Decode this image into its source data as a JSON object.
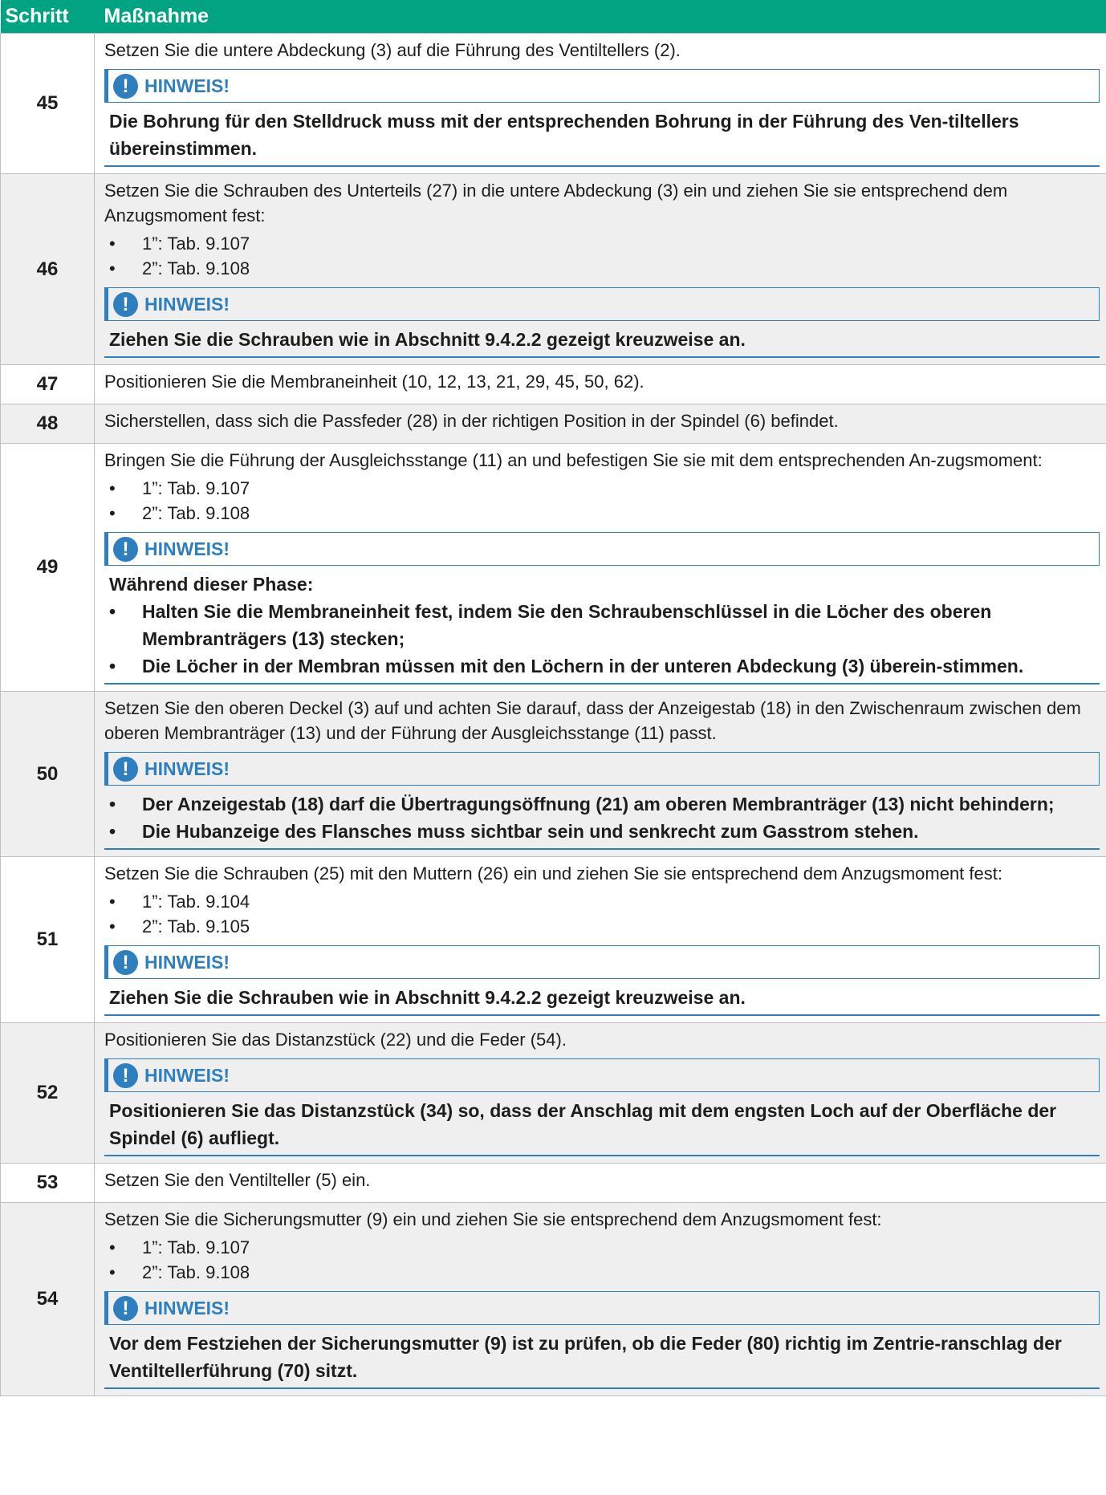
{
  "header": {
    "col_step": "Schritt",
    "col_action": "Maßnahme"
  },
  "note_label": "HINWEIS!",
  "note_icon": "!",
  "bullet": "•",
  "rows": [
    {
      "step": "45",
      "text": [
        "Setzen Sie die untere Abdeckung (3) auf die Führung des Ventiltellers (2)."
      ],
      "bullets": [],
      "note": [
        "Die Bohrung für den Stelldruck muss mit der entsprechenden Bohrung in der Führung des Ven-tiltellers übereinstimmen."
      ],
      "note_bullets": []
    },
    {
      "step": "46",
      "text": [
        "Setzen Sie die Schrauben des Unterteils (27) in die untere Abdeckung (3) ein und ziehen Sie sie entsprechend dem Anzugsmoment fest:"
      ],
      "bullets": [
        "1”: Tab. 9.107",
        "2”: Tab. 9.108"
      ],
      "note": [
        "Ziehen Sie die Schrauben wie in Abschnitt 9.4.2.2 gezeigt kreuzweise an."
      ],
      "note_bullets": []
    },
    {
      "step": "47",
      "text": [
        "Positionieren Sie die Membraneinheit (10, 12, 13, 21, 29, 45, 50, 62)."
      ],
      "bullets": [],
      "note": [],
      "note_bullets": []
    },
    {
      "step": "48",
      "text": [
        "Sicherstellen, dass sich die Passfeder (28) in der richtigen Position in der Spindel (6) befindet."
      ],
      "bullets": [],
      "note": [],
      "note_bullets": []
    },
    {
      "step": "49",
      "text": [
        "Bringen Sie die Führung der Ausgleichsstange (11) an und befestigen Sie sie mit dem entsprechenden An-zugsmoment:"
      ],
      "bullets": [
        "1”: Tab. 9.107",
        "2”: Tab. 9.108"
      ],
      "note": [
        "Während dieser Phase:"
      ],
      "note_bullets": [
        "Halten Sie die Membraneinheit fest, indem Sie den Schraubenschlüssel in die Löcher des oberen Membranträgers (13) stecken;",
        "Die Löcher in der Membran müssen mit den Löchern in der unteren Abdeckung (3) überein-stimmen."
      ]
    },
    {
      "step": "50",
      "text": [
        "Setzen Sie den oberen Deckel (3) auf und achten Sie darauf, dass der Anzeigestab (18) in den Zwischenraum zwischen dem oberen Membranträger (13) und der Führung der Ausgleichsstange (11) passt."
      ],
      "bullets": [],
      "note": [],
      "note_bullets": [
        "Der Anzeigestab (18) darf die Übertragungsöffnung (21) am oberen Membranträger (13) nicht behindern;",
        "Die Hubanzeige des Flansches muss sichtbar sein und senkrecht zum Gasstrom stehen."
      ]
    },
    {
      "step": "51",
      "text": [
        "Setzen Sie die Schrauben (25) mit den Muttern (26) ein und ziehen Sie sie entsprechend dem Anzugsmoment fest:"
      ],
      "bullets": [
        "1”: Tab. 9.104",
        "2”: Tab. 9.105"
      ],
      "note": [
        "Ziehen Sie die Schrauben wie in Abschnitt 9.4.2.2 gezeigt kreuzweise an."
      ],
      "note_bullets": []
    },
    {
      "step": "52",
      "text": [
        "Positionieren Sie das Distanzstück (22) und die Feder (54)."
      ],
      "bullets": [],
      "note": [
        "Positionieren Sie das Distanzstück (34) so, dass der Anschlag mit dem engsten Loch auf der Oberfläche der Spindel (6) aufliegt."
      ],
      "note_bullets": []
    },
    {
      "step": "53",
      "text": [
        "Setzen Sie den Ventilteller (5) ein."
      ],
      "bullets": [],
      "note": [],
      "note_bullets": []
    },
    {
      "step": "54",
      "text": [
        "Setzen Sie die Sicherungsmutter (9) ein und ziehen Sie sie entsprechend dem Anzugsmoment fest:"
      ],
      "bullets": [
        "1”: Tab. 9.107",
        "2”: Tab. 9.108"
      ],
      "note": [
        "Vor dem Festziehen der Sicherungsmutter (9) ist zu prüfen, ob die Feder (80) richtig im Zentrie-ranschlag der Ventiltellerführung (70) sitzt."
      ],
      "note_bullets": []
    }
  ],
  "row_has_note": [
    true,
    true,
    false,
    false,
    true,
    true,
    true,
    true,
    false,
    true
  ]
}
